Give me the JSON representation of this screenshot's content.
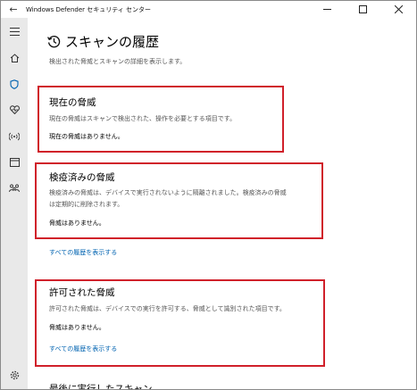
{
  "window": {
    "title": "Windows Defender セキュリティ センター",
    "back_glyph": "←",
    "minimize_glyph": "—",
    "maximize_glyph": "☐",
    "close_glyph": "✕"
  },
  "nav": {
    "items": [
      "menu",
      "home",
      "virus-threat-protection",
      "device-health",
      "firewall-network",
      "app-browser-control",
      "family-options",
      "settings"
    ]
  },
  "page": {
    "title": "スキャンの履歴",
    "subtitle": "検出された脅威とスキャンの詳細を表示します。"
  },
  "sections": {
    "current": {
      "heading": "現在の脅威",
      "desc": "現在の脅威はスキャンで検出された、操作を必要とする項目です。",
      "status": "現在の脅威はありません。"
    },
    "quarantined": {
      "heading": "検疫済みの脅威",
      "desc_line1": "検疫済みの脅威は、デバイスで実行されないように隔離されました。検疫済みの脅威",
      "desc_line2": "は定期的に削除されます。",
      "status": "脅威はありません。",
      "link": "すべての履歴を表示する"
    },
    "allowed": {
      "heading": "許可された脅威",
      "desc": "許可された脅威は、デバイスでの実行を許可する、脅威として識別された項目です。",
      "status": "脅威はありません。",
      "link": "すべての履歴を表示する"
    },
    "last_scan": {
      "heading": "最後に実行したスキャン"
    }
  },
  "colors": {
    "highlight_box": "#d0202a",
    "link": "#0063b1",
    "rail": "#e9e9e9"
  }
}
